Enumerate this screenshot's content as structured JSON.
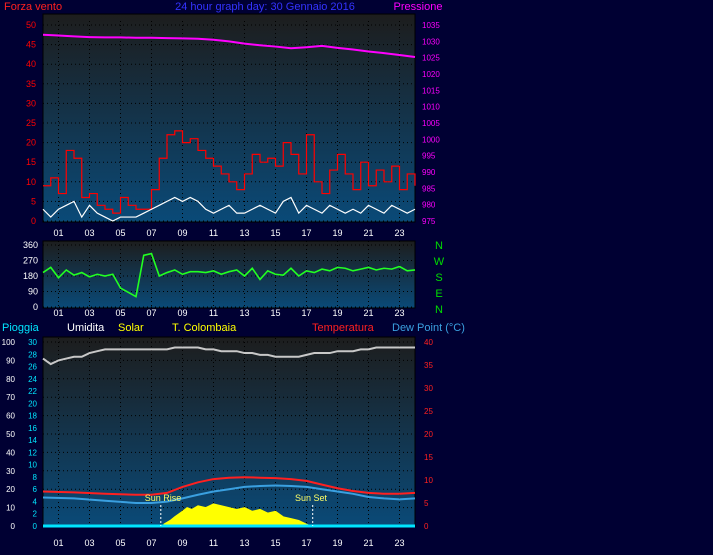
{
  "header": {
    "left_title": "Forza vento",
    "center_title": "24 hour graph day:  30 Gennaio 2016",
    "right_title": "Pressione"
  },
  "bottom_header": {
    "pioggia": "Pioggia",
    "umidita": "Umidita",
    "solar": "Solar",
    "colombaia": "T. Colombaia",
    "temperatura": "Temperatura",
    "dewpoint": "Dew Point (°C)"
  },
  "direction_labels": [
    "N",
    "W",
    "S",
    "E",
    "N"
  ],
  "annotations": {
    "sunrise": "Sun Rise",
    "sunset": "Sun Set"
  },
  "x_ticks": [
    "01",
    "03",
    "05",
    "07",
    "09",
    "11",
    "13",
    "15",
    "17",
    "19",
    "21",
    "23"
  ],
  "colors": {
    "background": "#000033",
    "plot_top": "#1d1d1d",
    "plot_bottom": "#0a4a78",
    "wind_gust": "#ff0000",
    "wind_avg": "#ffffff",
    "pressure": "#ff00ff",
    "direction": "#22ff22",
    "humidity": "#c8c8c8",
    "temperature": "#ff2020",
    "dewpoint": "#3aa0e0",
    "solar": "#ffff00",
    "rain": "#00e5ff",
    "title_blue": "#3333ff",
    "tick_white": "#ffffff",
    "green_axis": "#00dd00"
  },
  "chart_data": [
    {
      "type": "line",
      "panel": "wind-pressure",
      "title": "24 hour graph day:  30 Gennaio 2016",
      "ylabel": "Forza vento",
      "y2label": "Pressione",
      "ylim": [
        0,
        50
      ],
      "yticks": [
        0,
        5,
        10,
        15,
        20,
        25,
        30,
        35,
        40,
        45,
        50
      ],
      "y2lim": [
        975,
        1035
      ],
      "y2ticks": [
        975,
        980,
        985,
        990,
        995,
        1000,
        1005,
        1010,
        1015,
        1020,
        1025,
        1030,
        1035
      ],
      "xlim": [
        0,
        24
      ],
      "series": [
        {
          "axis": "y2",
          "color": "#ff00ff",
          "x": [
            0,
            1,
            2,
            3,
            4,
            5,
            6,
            7,
            8,
            9,
            10,
            11,
            12,
            13,
            14,
            15,
            16,
            17,
            18,
            19,
            20,
            21,
            22,
            23,
            24
          ],
          "values": [
            1032,
            1031.8,
            1031.5,
            1031.3,
            1031.2,
            1031.2,
            1031.1,
            1031.1,
            1031,
            1030.9,
            1030.8,
            1030.5,
            1030,
            1029.3,
            1028.8,
            1028.4,
            1027.9,
            1028.2,
            1028.6,
            1028,
            1027.5,
            1026.9,
            1026.4,
            1025.8,
            1025.2
          ]
        },
        {
          "axis": "y",
          "color": "#ff0000",
          "x": [
            0,
            0.5,
            1,
            1.5,
            2,
            2.5,
            3,
            3.5,
            4,
            4.5,
            5,
            5.5,
            6,
            6.5,
            7,
            7.5,
            8,
            8.5,
            9,
            9.5,
            10,
            10.5,
            11,
            11.5,
            12,
            12.5,
            13,
            13.5,
            14,
            14.5,
            15,
            15.5,
            16,
            16.5,
            17,
            17.5,
            18,
            18.5,
            19,
            19.5,
            20,
            20.5,
            21,
            21.5,
            22,
            22.5,
            23,
            23.5,
            24
          ],
          "values": [
            9,
            11,
            7,
            18,
            16,
            6,
            7,
            4,
            3,
            2,
            6,
            4,
            3,
            3,
            8,
            16,
            22,
            23,
            20,
            21,
            18,
            16,
            14,
            12,
            10,
            8,
            12,
            17,
            15,
            16,
            14,
            20,
            17,
            12,
            22,
            10,
            7,
            13,
            17,
            12,
            8,
            15,
            9,
            13,
            10,
            14,
            8,
            12,
            9
          ]
        },
        {
          "axis": "y",
          "color": "#ffffff",
          "x": [
            0,
            0.5,
            1,
            1.5,
            2,
            2.5,
            3,
            3.5,
            4,
            4.5,
            5,
            5.5,
            6,
            6.5,
            7,
            7.5,
            8,
            8.5,
            9,
            9.5,
            10,
            10.5,
            11,
            11.5,
            12,
            12.5,
            13,
            13.5,
            14,
            14.5,
            15,
            15.5,
            16,
            16.5,
            17,
            17.5,
            18,
            18.5,
            19,
            19.5,
            20,
            20.5,
            21,
            21.5,
            22,
            22.5,
            23,
            23.5,
            24
          ],
          "values": [
            3,
            1,
            3,
            4,
            5,
            1,
            4,
            2,
            1,
            0,
            1,
            1,
            1,
            2,
            3,
            4,
            5,
            6,
            5,
            6,
            5,
            3,
            2,
            3,
            4,
            2,
            2,
            3,
            4,
            3,
            2,
            5,
            6,
            2,
            4,
            3,
            2,
            4,
            3,
            2,
            3,
            2,
            4,
            3,
            2,
            4,
            3,
            2,
            3
          ]
        }
      ]
    },
    {
      "type": "line",
      "panel": "wind-direction",
      "ylim": [
        0,
        360
      ],
      "yticks": [
        0,
        90,
        180,
        270,
        360
      ],
      "xlim": [
        0,
        24
      ],
      "series": [
        {
          "color": "#22ff22",
          "x": [
            0,
            0.5,
            1,
            1.5,
            2,
            2.5,
            3,
            3.5,
            4,
            4.5,
            5,
            5.5,
            6,
            6.5,
            7,
            7.5,
            8,
            8.5,
            9,
            9.5,
            10,
            10.5,
            11,
            11.5,
            12,
            12.5,
            13,
            13.5,
            14,
            14.5,
            15,
            15.5,
            16,
            16.5,
            17,
            17.5,
            18,
            18.5,
            19,
            19.5,
            20,
            20.5,
            21,
            21.5,
            22,
            22.5,
            23,
            23.5,
            24
          ],
          "values": [
            200,
            230,
            170,
            215,
            185,
            200,
            175,
            190,
            180,
            190,
            110,
            85,
            60,
            300,
            310,
            180,
            200,
            215,
            190,
            205,
            205,
            200,
            210,
            190,
            205,
            215,
            180,
            225,
            160,
            210,
            190,
            185,
            225,
            180,
            210,
            200,
            220,
            210,
            230,
            225,
            210,
            220,
            230,
            215,
            225,
            220,
            235,
            210,
            215
          ]
        }
      ]
    },
    {
      "type": "line",
      "panel": "temperature-humidity",
      "ylim": [
        0,
        100
      ],
      "yticks": [
        0,
        10,
        20,
        30,
        40,
        50,
        60,
        70,
        80,
        90,
        100
      ],
      "xlim": [
        0,
        24
      ],
      "series": [
        {
          "axis": "humidity",
          "color": "#c8c8c8",
          "x": [
            0,
            0.5,
            1,
            1.5,
            2,
            2.5,
            3,
            3.5,
            4,
            4.5,
            5,
            5.5,
            6,
            6.5,
            7,
            7.5,
            8,
            8.5,
            9,
            9.5,
            10,
            10.5,
            11,
            11.5,
            12,
            12.5,
            13,
            13.5,
            14,
            14.5,
            15,
            15.5,
            16,
            16.5,
            17,
            17.5,
            18,
            18.5,
            19,
            19.5,
            20,
            20.5,
            21,
            21.5,
            22,
            22.5,
            23,
            23.5,
            24
          ],
          "values": [
            91,
            88,
            90,
            91,
            92,
            92,
            94,
            95,
            96,
            96,
            96,
            96,
            96,
            96,
            96,
            96,
            96,
            97,
            97,
            97,
            97,
            96,
            96,
            95,
            95,
            95,
            94,
            94,
            93,
            93,
            92,
            92,
            92,
            92,
            93,
            94,
            94,
            94,
            95,
            95,
            95,
            96,
            96,
            97,
            97,
            97,
            97,
            97,
            97
          ]
        },
        {
          "axis": "temperature",
          "color": "#ff2020",
          "x": [
            0,
            2,
            4,
            6,
            7,
            8,
            9,
            10,
            11,
            12,
            13,
            14,
            15,
            16,
            17,
            18,
            19,
            20,
            21,
            22,
            23,
            24
          ],
          "values": [
            7.5,
            7.3,
            7.0,
            6.8,
            6.8,
            7.2,
            8.5,
            9.5,
            10.2,
            10.5,
            10.6,
            10.5,
            10.4,
            10.2,
            9.8,
            9.0,
            8.2,
            7.6,
            7.2,
            7.0,
            7.0,
            7.2
          ]
        },
        {
          "axis": "temperature",
          "color": "#3aa0e0",
          "x": [
            0,
            2,
            4,
            6,
            7,
            8,
            9,
            10,
            11,
            12,
            13,
            14,
            15,
            16,
            17,
            18,
            19,
            20,
            21,
            22,
            23,
            24
          ],
          "values": [
            6.2,
            6.0,
            5.5,
            5.0,
            5.0,
            5.3,
            6.0,
            6.8,
            7.5,
            8.0,
            8.5,
            8.7,
            8.8,
            8.7,
            8.5,
            8.0,
            7.5,
            7.0,
            6.3,
            6.0,
            5.8,
            6.0
          ]
        },
        {
          "axis": "solar",
          "color": "#ffff00",
          "type": "area",
          "x": [
            7.8,
            8.2,
            8.5,
            9,
            9.3,
            9.6,
            10,
            10.5,
            11,
            11.5,
            12,
            12.5,
            13,
            13.5,
            14,
            14.5,
            15,
            15.5,
            16,
            16.5,
            17,
            17.3
          ],
          "values": [
            1,
            3,
            5,
            8,
            10,
            9,
            11,
            10,
            12,
            11,
            10,
            9,
            10,
            8,
            9,
            7,
            8,
            5,
            4,
            3,
            1,
            0
          ]
        },
        {
          "axis": "rain",
          "color": "#00e5ff",
          "x": [
            0,
            24
          ],
          "values": [
            0,
            0
          ]
        }
      ],
      "temperature_axis": {
        "ylim": [
          0,
          40
        ],
        "yticks": [
          0,
          5,
          10,
          15,
          20,
          25,
          30,
          35,
          40
        ]
      },
      "humidity_axis": {
        "yticks": [
          0,
          2,
          4,
          6,
          8,
          10,
          12,
          14,
          16,
          18,
          20,
          22,
          24,
          26,
          28,
          30
        ]
      },
      "sunrise_hour": 7.6,
      "sunset_hour": 17.4
    }
  ]
}
